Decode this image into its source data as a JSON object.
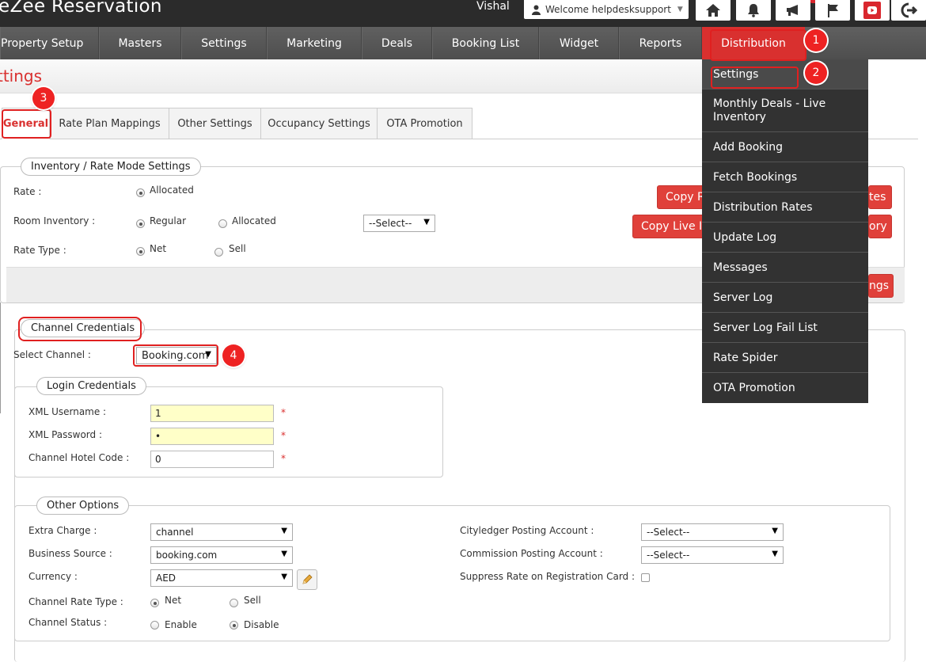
{
  "header": {
    "brand": "eZee Reservation",
    "user_name": "Vishal",
    "welcome": "Welcome helpdesksupport",
    "icons": [
      "home-icon",
      "bell-icon",
      "megaphone-icon",
      "flag-icon",
      "youtube-icon",
      "logout-icon"
    ]
  },
  "nav": {
    "items": [
      "Property Setup",
      "Masters",
      "Settings",
      "Marketing",
      "Deals",
      "Booking List",
      "Widget",
      "Reports",
      "Distribution"
    ],
    "active": "Distribution"
  },
  "dropdown": {
    "items": [
      "Settings",
      "Monthly Deals - Live Inventory",
      "Add Booking",
      "Fetch Bookings",
      "Distribution Rates",
      "Update Log",
      "Messages",
      "Server Log",
      "Server Log Fail List",
      "Rate Spider",
      "OTA Promotion"
    ]
  },
  "page": {
    "title": "ttings"
  },
  "tabs": [
    "General",
    "Rate Plan Mappings",
    "Other Settings",
    "Occupancy Settings",
    "OTA Promotion"
  ],
  "inventory": {
    "legend": "Inventory / Rate Mode Settings",
    "rate_label": "Rate :",
    "rate_option": "Allocated",
    "room_inventory_label": "Room Inventory :",
    "room_inventory_options": [
      "Regular",
      "Allocated"
    ],
    "room_inventory_select": "--Select--",
    "rate_type_label": "Rate Type :",
    "rate_type_options": [
      "Net",
      "Sell"
    ],
    "buttons": [
      "Copy R",
      "tes",
      "Copy Live I",
      "ory",
      "ngs"
    ]
  },
  "channel": {
    "legend": "Channel Credentials",
    "select_label": "Select Channel :",
    "select_value": "Booking.com"
  },
  "login": {
    "legend": "Login Credentials",
    "username_label": "XML Username :",
    "username_value": "1",
    "password_label": "XML Password :",
    "password_value": "•",
    "hotel_code_label": "Channel Hotel Code :",
    "hotel_code_value": "0",
    "required": "*"
  },
  "other": {
    "legend": "Other Options",
    "extra_charge_label": "Extra Charge :",
    "extra_charge_value": "channel",
    "business_source_label": "Business Source :",
    "business_source_value": "booking.com",
    "currency_label": "Currency :",
    "currency_value": "AED",
    "channel_rate_type_label": "Channel Rate Type :",
    "channel_rate_type_options": [
      "Net",
      "Sell"
    ],
    "channel_status_label": "Channel Status :",
    "channel_status_options": [
      "Enable",
      "Disable"
    ],
    "cityledger_label": "Cityledger Posting Account :",
    "cityledger_value": "--Select--",
    "commission_label": "Commission Posting Account :",
    "commission_value": "--Select--",
    "suppress_label": "Suppress Rate on Registration Card :"
  },
  "annotations": [
    "1",
    "2",
    "3",
    "4"
  ]
}
